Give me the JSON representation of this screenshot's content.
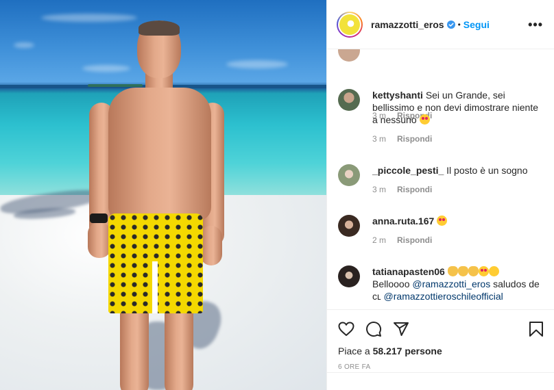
{
  "post": {
    "username": "ramazzotti_eros",
    "follow_label": "Segui",
    "separator": "•",
    "more_label": "•••"
  },
  "partial_comment": {
    "text": "",
    "time": "3 m",
    "reply_label": "Rispondi"
  },
  "comments": [
    {
      "username": "kettyshanti",
      "text": "Sei un Grande, sei bellissimo e non devi dimostrare niente a nessuno",
      "time": "3 m",
      "reply_label": "Rispondi"
    },
    {
      "username": "_piccole_pesti_",
      "text": "Il posto è un sogno",
      "time": "3 m",
      "reply_label": "Rispondi"
    },
    {
      "username": "anna.ruta.167",
      "text": "",
      "time": "2 m",
      "reply_label": "Rispondi"
    },
    {
      "username": "tatianapasten06",
      "text_prefix": "Belloooo",
      "mention_1": "@ramazzotti_eros",
      "text_middle": "saludos de ᴄʟ",
      "mention_2": "@ramazzottieroschileofficial"
    }
  ],
  "likes": {
    "prefix": "Piace a",
    "count": "58.217",
    "suffix": "persone"
  },
  "time_ago": "6 ORE FA",
  "colors": {
    "follow": "#0095f6",
    "mention": "#00376b",
    "muted": "#8e8e8e",
    "shorts": "#f4d800"
  },
  "icons": {
    "like": "heart-icon",
    "comment": "comment-bubble-icon",
    "share": "paper-plane-icon",
    "save": "bookmark-icon",
    "verified": "verified-badge-icon"
  }
}
